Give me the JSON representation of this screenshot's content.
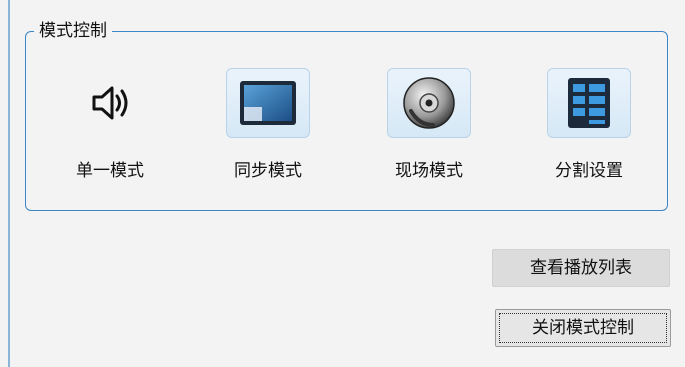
{
  "group": {
    "title": "模式控制"
  },
  "modes": [
    {
      "label": "单一模式",
      "icon": "speaker-icon",
      "selected": false
    },
    {
      "label": "同步模式",
      "icon": "sync-screen-icon",
      "selected": true
    },
    {
      "label": "现场模式",
      "icon": "disc-icon",
      "selected": true
    },
    {
      "label": "分割设置",
      "icon": "grid-split-icon",
      "selected": true
    }
  ],
  "buttons": {
    "view_playlist": "查看播放列表",
    "close_mode_control": "关闭模式控制"
  },
  "colors": {
    "groupbox_border": "#3b86c6",
    "accent_blue": "#1f6fb5"
  }
}
